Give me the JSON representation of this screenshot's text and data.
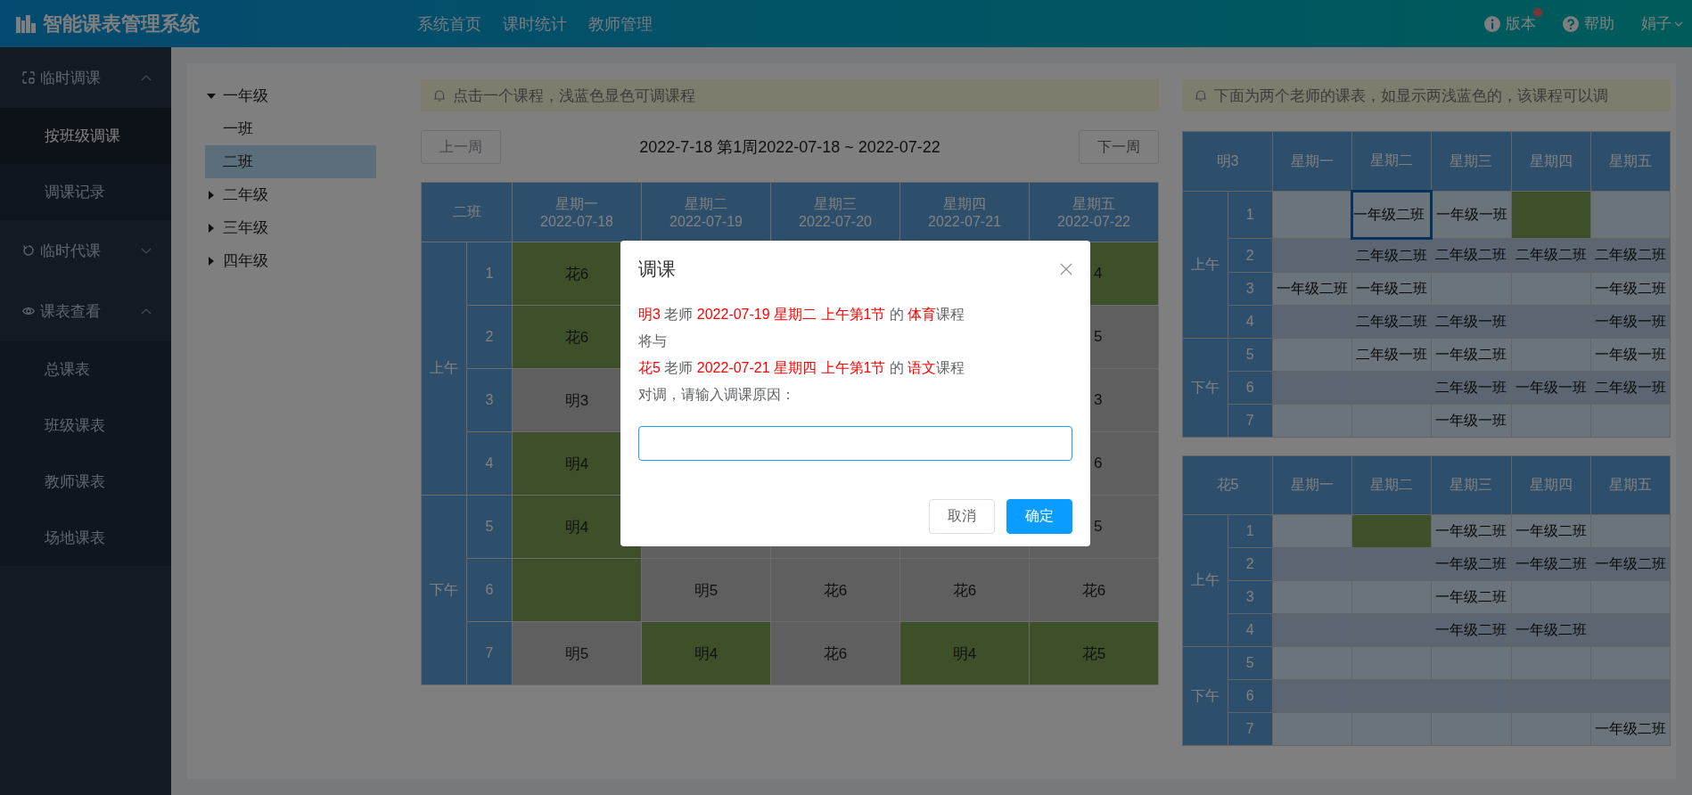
{
  "app": {
    "title": "智能课表管理系统"
  },
  "nav": [
    {
      "label": "系统首页"
    },
    {
      "label": "课时统计"
    },
    {
      "label": "教师管理"
    }
  ],
  "header_actions": [
    {
      "kind": "info",
      "label": "版本",
      "badge": true
    },
    {
      "kind": "help",
      "label": "帮助",
      "badge": false
    }
  ],
  "user": {
    "name": "娟子"
  },
  "sidebar": [
    {
      "label": "临时调课",
      "kind": "swap",
      "expanded": true,
      "children": [
        {
          "label": "按班级调课",
          "selected": true
        },
        {
          "label": "调课记录",
          "selected": false
        }
      ]
    },
    {
      "label": "临时代课",
      "kind": "refresh",
      "expanded": false
    },
    {
      "label": "课表查看",
      "kind": "eye",
      "expanded": true,
      "children": [
        {
          "label": "总课表",
          "selected": false
        },
        {
          "label": "班级课表",
          "selected": false
        },
        {
          "label": "教师课表",
          "selected": false
        },
        {
          "label": "场地课表",
          "selected": false
        }
      ]
    }
  ],
  "tree": [
    {
      "label": "一年级",
      "expanded": true,
      "children": [
        {
          "label": "一班",
          "selected": false
        },
        {
          "label": "二班",
          "selected": true
        }
      ]
    },
    {
      "label": "二年级",
      "expanded": false
    },
    {
      "label": "三年级",
      "expanded": false
    },
    {
      "label": "四年级",
      "expanded": false
    }
  ],
  "class_schedule": {
    "notice": "点击一个课程，浅蓝色显色可调课程",
    "prev_button": "上一周",
    "next_button": "下一周",
    "week_title": "2022-7-18 第1周2022-07-18 ~ 2022-07-22",
    "corner": "二班",
    "days": [
      {
        "name": "星期一",
        "date": "2022-07-18"
      },
      {
        "name": "星期二",
        "date": "2022-07-19"
      },
      {
        "name": "星期三",
        "date": "2022-07-20"
      },
      {
        "name": "星期四",
        "date": "2022-07-21"
      },
      {
        "name": "星期五",
        "date": "2022-07-22"
      }
    ],
    "periods": [
      {
        "label": "上午",
        "slots": [
          "1",
          "2",
          "3",
          "4"
        ]
      },
      {
        "label": "下午",
        "slots": [
          "5",
          "6",
          "7"
        ]
      }
    ],
    "rows": [
      [
        {
          "text": "花6",
          "kind": "green"
        },
        null,
        null,
        null,
        {
          "text": "4",
          "kind": "green",
          "clipped": true
        }
      ],
      [
        {
          "text": "花6",
          "kind": "green"
        },
        null,
        null,
        null,
        {
          "text": "5",
          "kind": "gray",
          "clipped": true
        }
      ],
      [
        {
          "text": "明3",
          "kind": "gray"
        },
        null,
        null,
        null,
        {
          "text": "3",
          "kind": "gray",
          "clipped": true
        }
      ],
      [
        {
          "text": "明4",
          "kind": "green"
        },
        null,
        null,
        null,
        {
          "text": "6",
          "kind": "gray",
          "clipped": true
        }
      ],
      [
        {
          "text": "明4",
          "kind": "green"
        },
        null,
        null,
        null,
        {
          "text": "5",
          "kind": "gray",
          "clipped": true
        }
      ],
      [
        {
          "kind": "green"
        },
        {
          "text": "明5",
          "kind": "gray"
        },
        {
          "text": "花6",
          "kind": "gray"
        },
        {
          "text": "花6",
          "kind": "gray"
        },
        {
          "text": "花6",
          "kind": "gray"
        }
      ],
      [
        {
          "text": "明5",
          "kind": "gray"
        },
        {
          "text": "明4",
          "kind": "green"
        },
        {
          "text": "花6",
          "kind": "gray"
        },
        {
          "text": "明4",
          "kind": "green"
        },
        {
          "text": "花5",
          "kind": "green"
        }
      ]
    ]
  },
  "teacher_notice": "下面为两个老师的课表，如显示两浅蓝色的，该课程可以调",
  "teacher_tables": [
    {
      "teacher": "明3",
      "days": [
        "星期一",
        "星期二",
        "星期三",
        "星期四",
        "星期五"
      ],
      "periods": [
        {
          "label": "上午",
          "slots": [
            "1",
            "2",
            "3",
            "4"
          ]
        },
        {
          "label": "下午",
          "slots": [
            "5",
            "6",
            "7"
          ]
        }
      ],
      "rows": [
        [
          null,
          {
            "text": "一年级二班",
            "kind": "plain",
            "selected": true
          },
          {
            "text": "一年级一班",
            "kind": "plain",
            "selected": false
          },
          {
            "kind": "green",
            "selected": false
          },
          null
        ],
        [
          null,
          {
            "text": "二年级二班",
            "kind": "plain",
            "selected": false
          },
          {
            "text": "二年级二班",
            "kind": "plain",
            "selected": false
          },
          {
            "text": "二年级二班",
            "kind": "plain",
            "selected": false
          },
          {
            "text": "二年级二班",
            "kind": "plain",
            "selected": false
          }
        ],
        [
          {
            "text": "一年级二班",
            "kind": "plain",
            "selected": false
          },
          {
            "text": "一年级二班",
            "kind": "plain",
            "selected": false
          },
          null,
          null,
          {
            "text": "一年级二班",
            "kind": "plain",
            "selected": false
          }
        ],
        [
          null,
          {
            "text": "二年级二班",
            "kind": "plain",
            "selected": false
          },
          {
            "text": "二年级一班",
            "kind": "plain",
            "selected": false
          },
          null,
          {
            "text": "一年级一班",
            "kind": "plain",
            "selected": false
          }
        ],
        [
          null,
          {
            "text": "二年级一班",
            "kind": "plain",
            "selected": false
          },
          {
            "text": "一年级二班",
            "kind": "plain",
            "selected": false
          },
          null,
          {
            "text": "一年级一班",
            "kind": "plain",
            "selected": false
          }
        ],
        [
          null,
          null,
          {
            "text": "二年级一班",
            "kind": "plain",
            "selected": false
          },
          {
            "text": "一年级一班",
            "kind": "plain",
            "selected": false
          },
          {
            "text": "二年级一班",
            "kind": "plain",
            "selected": false
          }
        ],
        [
          null,
          null,
          {
            "text": "一年级一班",
            "kind": "plain",
            "selected": false
          },
          null,
          null
        ]
      ]
    },
    {
      "teacher": "花5",
      "days": [
        "星期一",
        "星期二",
        "星期三",
        "星期四",
        "星期五"
      ],
      "periods": [
        {
          "label": "上午",
          "slots": [
            "1",
            "2",
            "3",
            "4"
          ]
        },
        {
          "label": "下午",
          "slots": [
            "5",
            "6",
            "7"
          ]
        }
      ],
      "rows": [
        [
          null,
          {
            "kind": "green",
            "selected": false
          },
          {
            "text": "一年级二班",
            "kind": "plain",
            "selected": false
          },
          {
            "text": "一年级二班",
            "kind": "plain",
            "selected": false
          },
          null
        ],
        [
          null,
          null,
          {
            "text": "一年级二班",
            "kind": "plain",
            "selected": false
          },
          {
            "text": "一年级二班",
            "kind": "plain",
            "selected": false
          },
          {
            "text": "一年级二班",
            "kind": "plain",
            "selected": false
          }
        ],
        [
          null,
          null,
          {
            "text": "一年级二班",
            "kind": "plain",
            "selected": false
          },
          null,
          null
        ],
        [
          null,
          null,
          {
            "text": "一年级二班",
            "kind": "plain",
            "selected": false
          },
          {
            "text": "一年级二班",
            "kind": "plain",
            "selected": false
          },
          null
        ],
        [
          null,
          null,
          null,
          null,
          null
        ],
        [
          null,
          null,
          null,
          null,
          null
        ],
        [
          null,
          null,
          null,
          null,
          {
            "text": "一年级二班",
            "kind": "plain",
            "selected": false
          }
        ]
      ]
    }
  ],
  "modal": {
    "title": "调课",
    "lines": [
      [
        {
          "text": "明3",
          "highlight": true
        },
        {
          "text": " 老师 ",
          "highlight": false
        },
        {
          "text": "2022-07-19 星期二 上午第1节",
          "highlight": true
        },
        {
          "text": " 的 ",
          "highlight": false
        },
        {
          "text": "体育",
          "highlight": true
        },
        {
          "text": "课程",
          "highlight": false
        }
      ],
      [
        {
          "text": "将与",
          "highlight": false
        }
      ],
      [
        {
          "text": "花5",
          "highlight": true
        },
        {
          "text": " 老师 ",
          "highlight": false
        },
        {
          "text": "2022-07-21 星期四 上午第1节",
          "highlight": true
        },
        {
          "text": " 的 ",
          "highlight": false
        },
        {
          "text": "语文",
          "highlight": true
        },
        {
          "text": "课程",
          "highlight": false
        }
      ],
      [
        {
          "text": "对调，请输入调课原因：",
          "highlight": false
        }
      ]
    ],
    "input": {
      "focused": true
    },
    "buttons": [
      {
        "label": "取消",
        "kind": "default"
      },
      {
        "label": "确定",
        "kind": "primary"
      }
    ]
  }
}
